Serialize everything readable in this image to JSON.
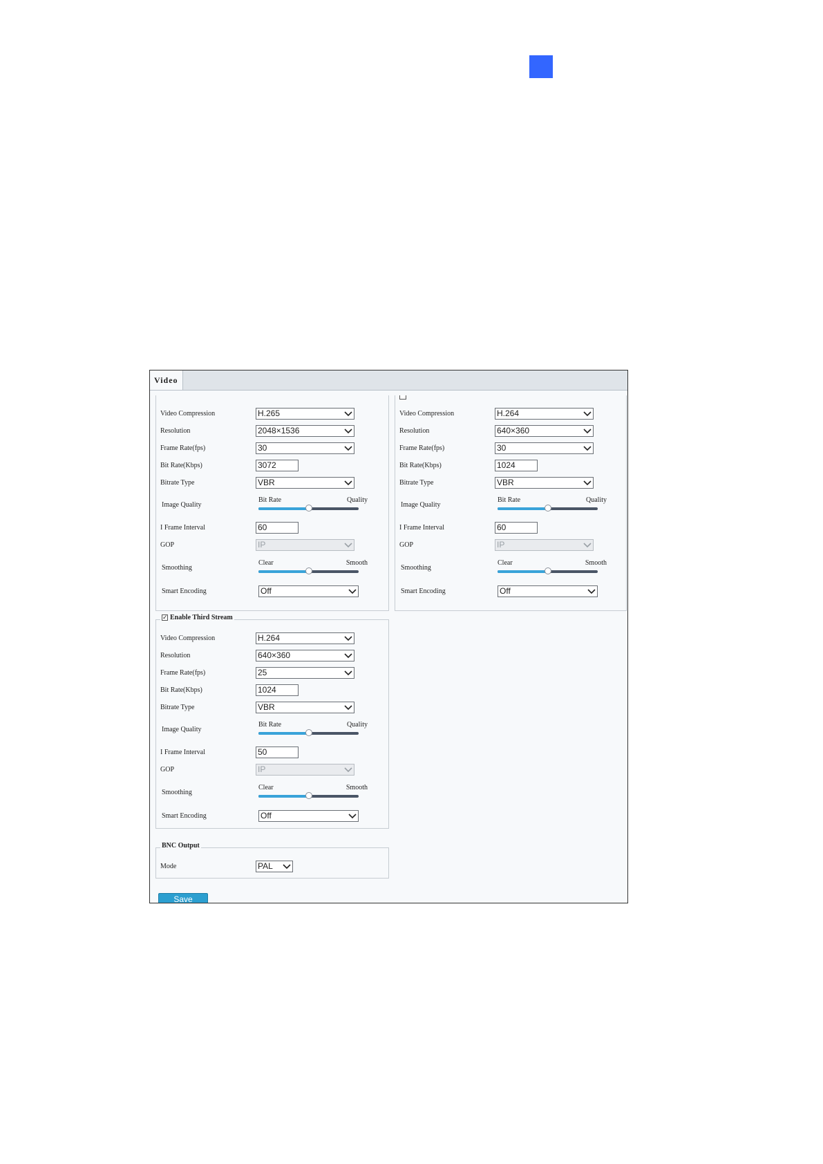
{
  "window": {
    "tab_label": "Video"
  },
  "main_stream": {
    "video_compression": {
      "label": "Video Compression",
      "value": "H.265"
    },
    "resolution": {
      "label": "Resolution",
      "value": "2048×1536"
    },
    "frame_rate": {
      "label": "Frame Rate(fps)",
      "value": "30"
    },
    "bit_rate": {
      "label": "Bit Rate(Kbps)",
      "value": "3072"
    },
    "bitrate_type": {
      "label": "Bitrate Type",
      "value": "VBR"
    },
    "image_quality": {
      "label": "Image Quality",
      "left": "Bit Rate",
      "right": "Quality",
      "level": 0.5
    },
    "i_frame_interval": {
      "label": "I Frame Interval",
      "value": "60"
    },
    "gop": {
      "label": "GOP",
      "value": "IP"
    },
    "smoothing": {
      "label": "Smoothing",
      "left": "Clear",
      "right": "Smooth",
      "level": 0.5
    },
    "smart_encoding": {
      "label": "Smart Encoding",
      "value": "Off"
    }
  },
  "sub_stream": {
    "video_compression": {
      "label": "Video Compression",
      "value": "H.264"
    },
    "resolution": {
      "label": "Resolution",
      "value": "640×360"
    },
    "frame_rate": {
      "label": "Frame Rate(fps)",
      "value": "30"
    },
    "bit_rate": {
      "label": "Bit Rate(Kbps)",
      "value": "1024"
    },
    "bitrate_type": {
      "label": "Bitrate Type",
      "value": "VBR"
    },
    "image_quality": {
      "label": "Image Quality",
      "left": "Bit Rate",
      "right": "Quality",
      "level": 0.5
    },
    "i_frame_interval": {
      "label": "I Frame Interval",
      "value": "60"
    },
    "gop": {
      "label": "GOP",
      "value": "IP"
    },
    "smoothing": {
      "label": "Smoothing",
      "left": "Clear",
      "right": "Smooth",
      "level": 0.5
    },
    "smart_encoding": {
      "label": "Smart Encoding",
      "value": "Off"
    }
  },
  "third_stream": {
    "enable_label": "Enable Third Stream",
    "enabled": true,
    "check_glyph": "✓",
    "video_compression": {
      "label": "Video Compression",
      "value": "H.264"
    },
    "resolution": {
      "label": "Resolution",
      "value": "640×360"
    },
    "frame_rate": {
      "label": "Frame Rate(fps)",
      "value": "25"
    },
    "bit_rate": {
      "label": "Bit Rate(Kbps)",
      "value": "1024"
    },
    "bitrate_type": {
      "label": "Bitrate Type",
      "value": "VBR"
    },
    "image_quality": {
      "label": "Image Quality",
      "left": "Bit Rate",
      "right": "Quality",
      "level": 0.5
    },
    "i_frame_interval": {
      "label": "I Frame Interval",
      "value": "50"
    },
    "gop": {
      "label": "GOP",
      "value": "IP"
    },
    "smoothing": {
      "label": "Smoothing",
      "left": "Clear",
      "right": "Smooth",
      "level": 0.5
    },
    "smart_encoding": {
      "label": "Smart Encoding",
      "value": "Off"
    }
  },
  "bnc_output": {
    "title": "BNC Output",
    "mode_label": "Mode",
    "mode_value": "PAL"
  },
  "actions": {
    "save_label": "Save"
  },
  "colors": {
    "accent": "#2c9fd0",
    "badge": "#3366ff",
    "track": "#4a5566",
    "track_fill": "#39a3d9"
  }
}
